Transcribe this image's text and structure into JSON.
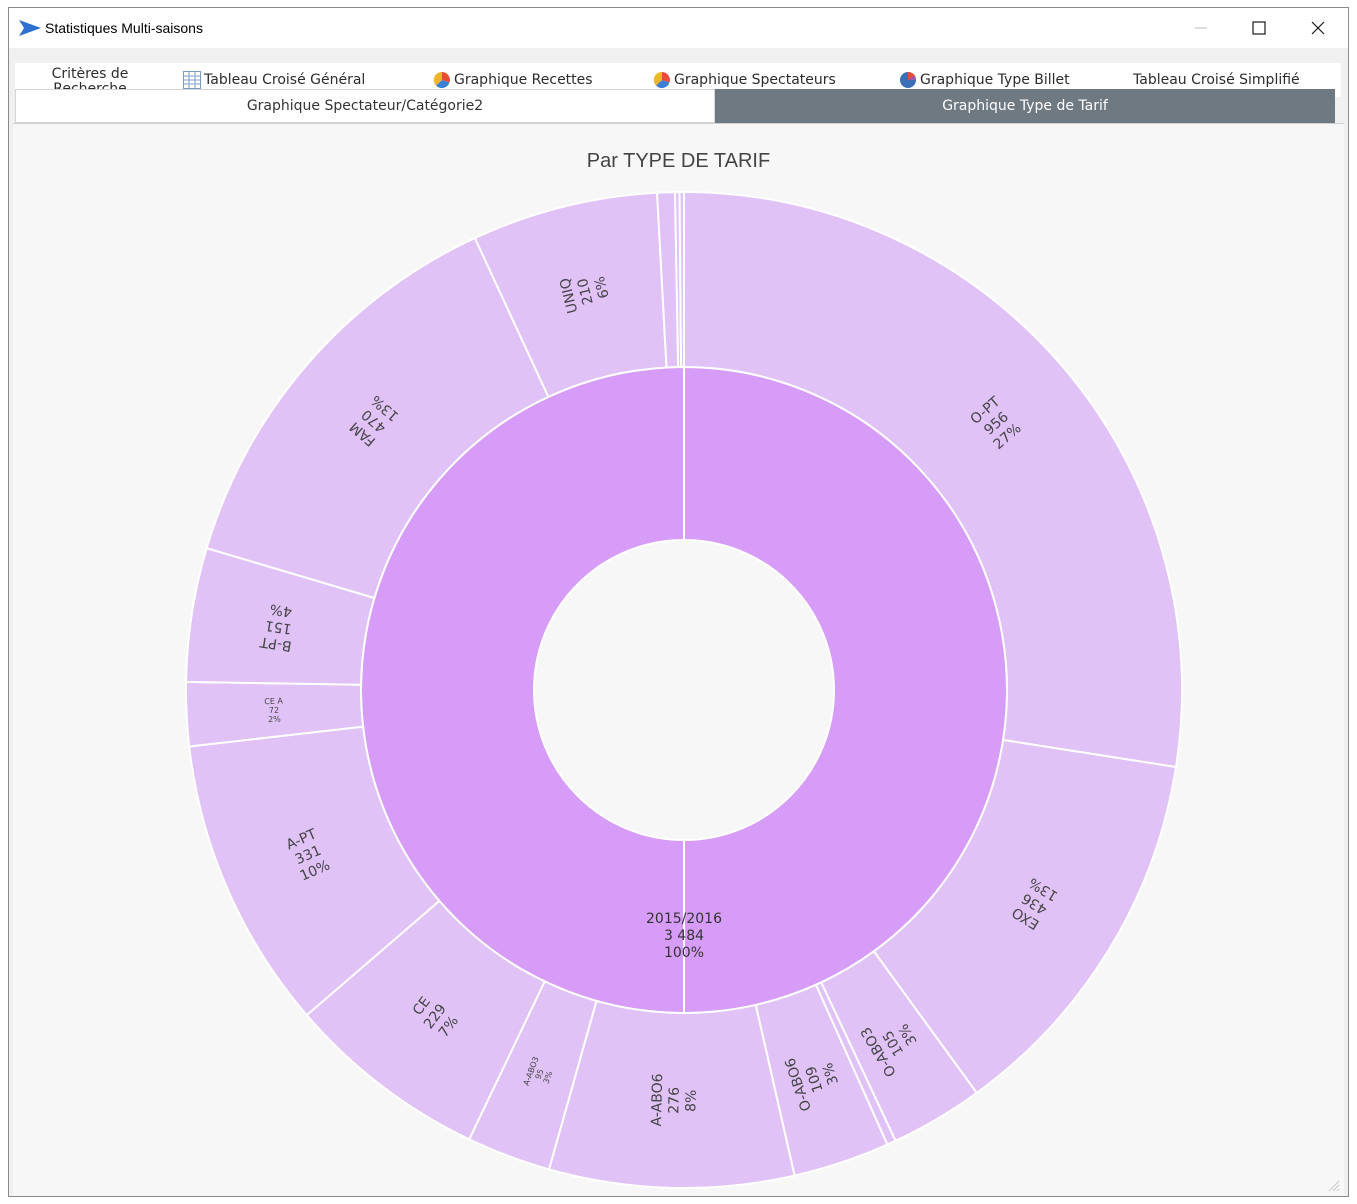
{
  "window": {
    "title": "Statistiques Multi-saisons",
    "controls": [
      "minimize",
      "maximize",
      "close"
    ]
  },
  "tabs_row1": [
    {
      "label": "Critères de Recherche",
      "icon": ""
    },
    {
      "label": "Tableau Croisé Général",
      "icon": "table-icon"
    },
    {
      "label": "Graphique Recettes",
      "icon": "pie-chart-icon"
    },
    {
      "label": "Graphique Spectateurs",
      "icon": "pie-chart-icon"
    },
    {
      "label": "Graphique Type Billet",
      "icon": "pie-chart-blue-icon"
    },
    {
      "label": "Tableau Croisé Simplifié",
      "icon": ""
    }
  ],
  "tabs_row2": [
    {
      "label": "Graphique Spectateur/Catégorie2",
      "active": false
    },
    {
      "label": "Graphique Type de Tarif",
      "active": true
    }
  ],
  "colors": {
    "inner_ring": "#d79cf7",
    "outer_ring": "#e1c2f7",
    "active_tab": "#6e7982"
  },
  "chart_data": {
    "type": "sunburst",
    "title": "Par TYPE DE TARIF",
    "root": {
      "name": "2015/2016",
      "value_label": "3 484",
      "percent": "100%",
      "value": 3484
    },
    "children": [
      {
        "name": "O-PT",
        "value_label": "956",
        "percent": "27%",
        "value": 956
      },
      {
        "name": "EXO",
        "value_label": "436",
        "percent": "13%",
        "value": 436
      },
      {
        "name": "O-ABO3",
        "value_label": "105",
        "percent": "3%",
        "value": 105
      },
      {
        "name": "",
        "value_label": "",
        "percent": "",
        "value": 10
      },
      {
        "name": "O-ABO6",
        "value_label": "109",
        "percent": "3%",
        "value": 109
      },
      {
        "name": "A-ABO6",
        "value_label": "276",
        "percent": "8%",
        "value": 276
      },
      {
        "name": "A-ABO3",
        "value_label": "95",
        "percent": "3%",
        "value": 95
      },
      {
        "name": "CE",
        "value_label": "229",
        "percent": "7%",
        "value": 229
      },
      {
        "name": "A-PT",
        "value_label": "331",
        "percent": "10%",
        "value": 331
      },
      {
        "name": "CE A",
        "value_label": "72",
        "percent": "2%",
        "value": 72
      },
      {
        "name": "B-PT",
        "value_label": "151",
        "percent": "4%",
        "value": 151
      },
      {
        "name": "FAM",
        "value_label": "470",
        "percent": "13%",
        "value": 470
      },
      {
        "name": "UNIQ",
        "value_label": "210",
        "percent": "6%",
        "value": 210
      },
      {
        "name": "",
        "value_label": "",
        "percent": "",
        "value": 20
      },
      {
        "name": "",
        "value_label": "",
        "percent": "",
        "value": 5
      },
      {
        "name": "",
        "value_label": "",
        "percent": "",
        "value": 5
      }
    ]
  }
}
